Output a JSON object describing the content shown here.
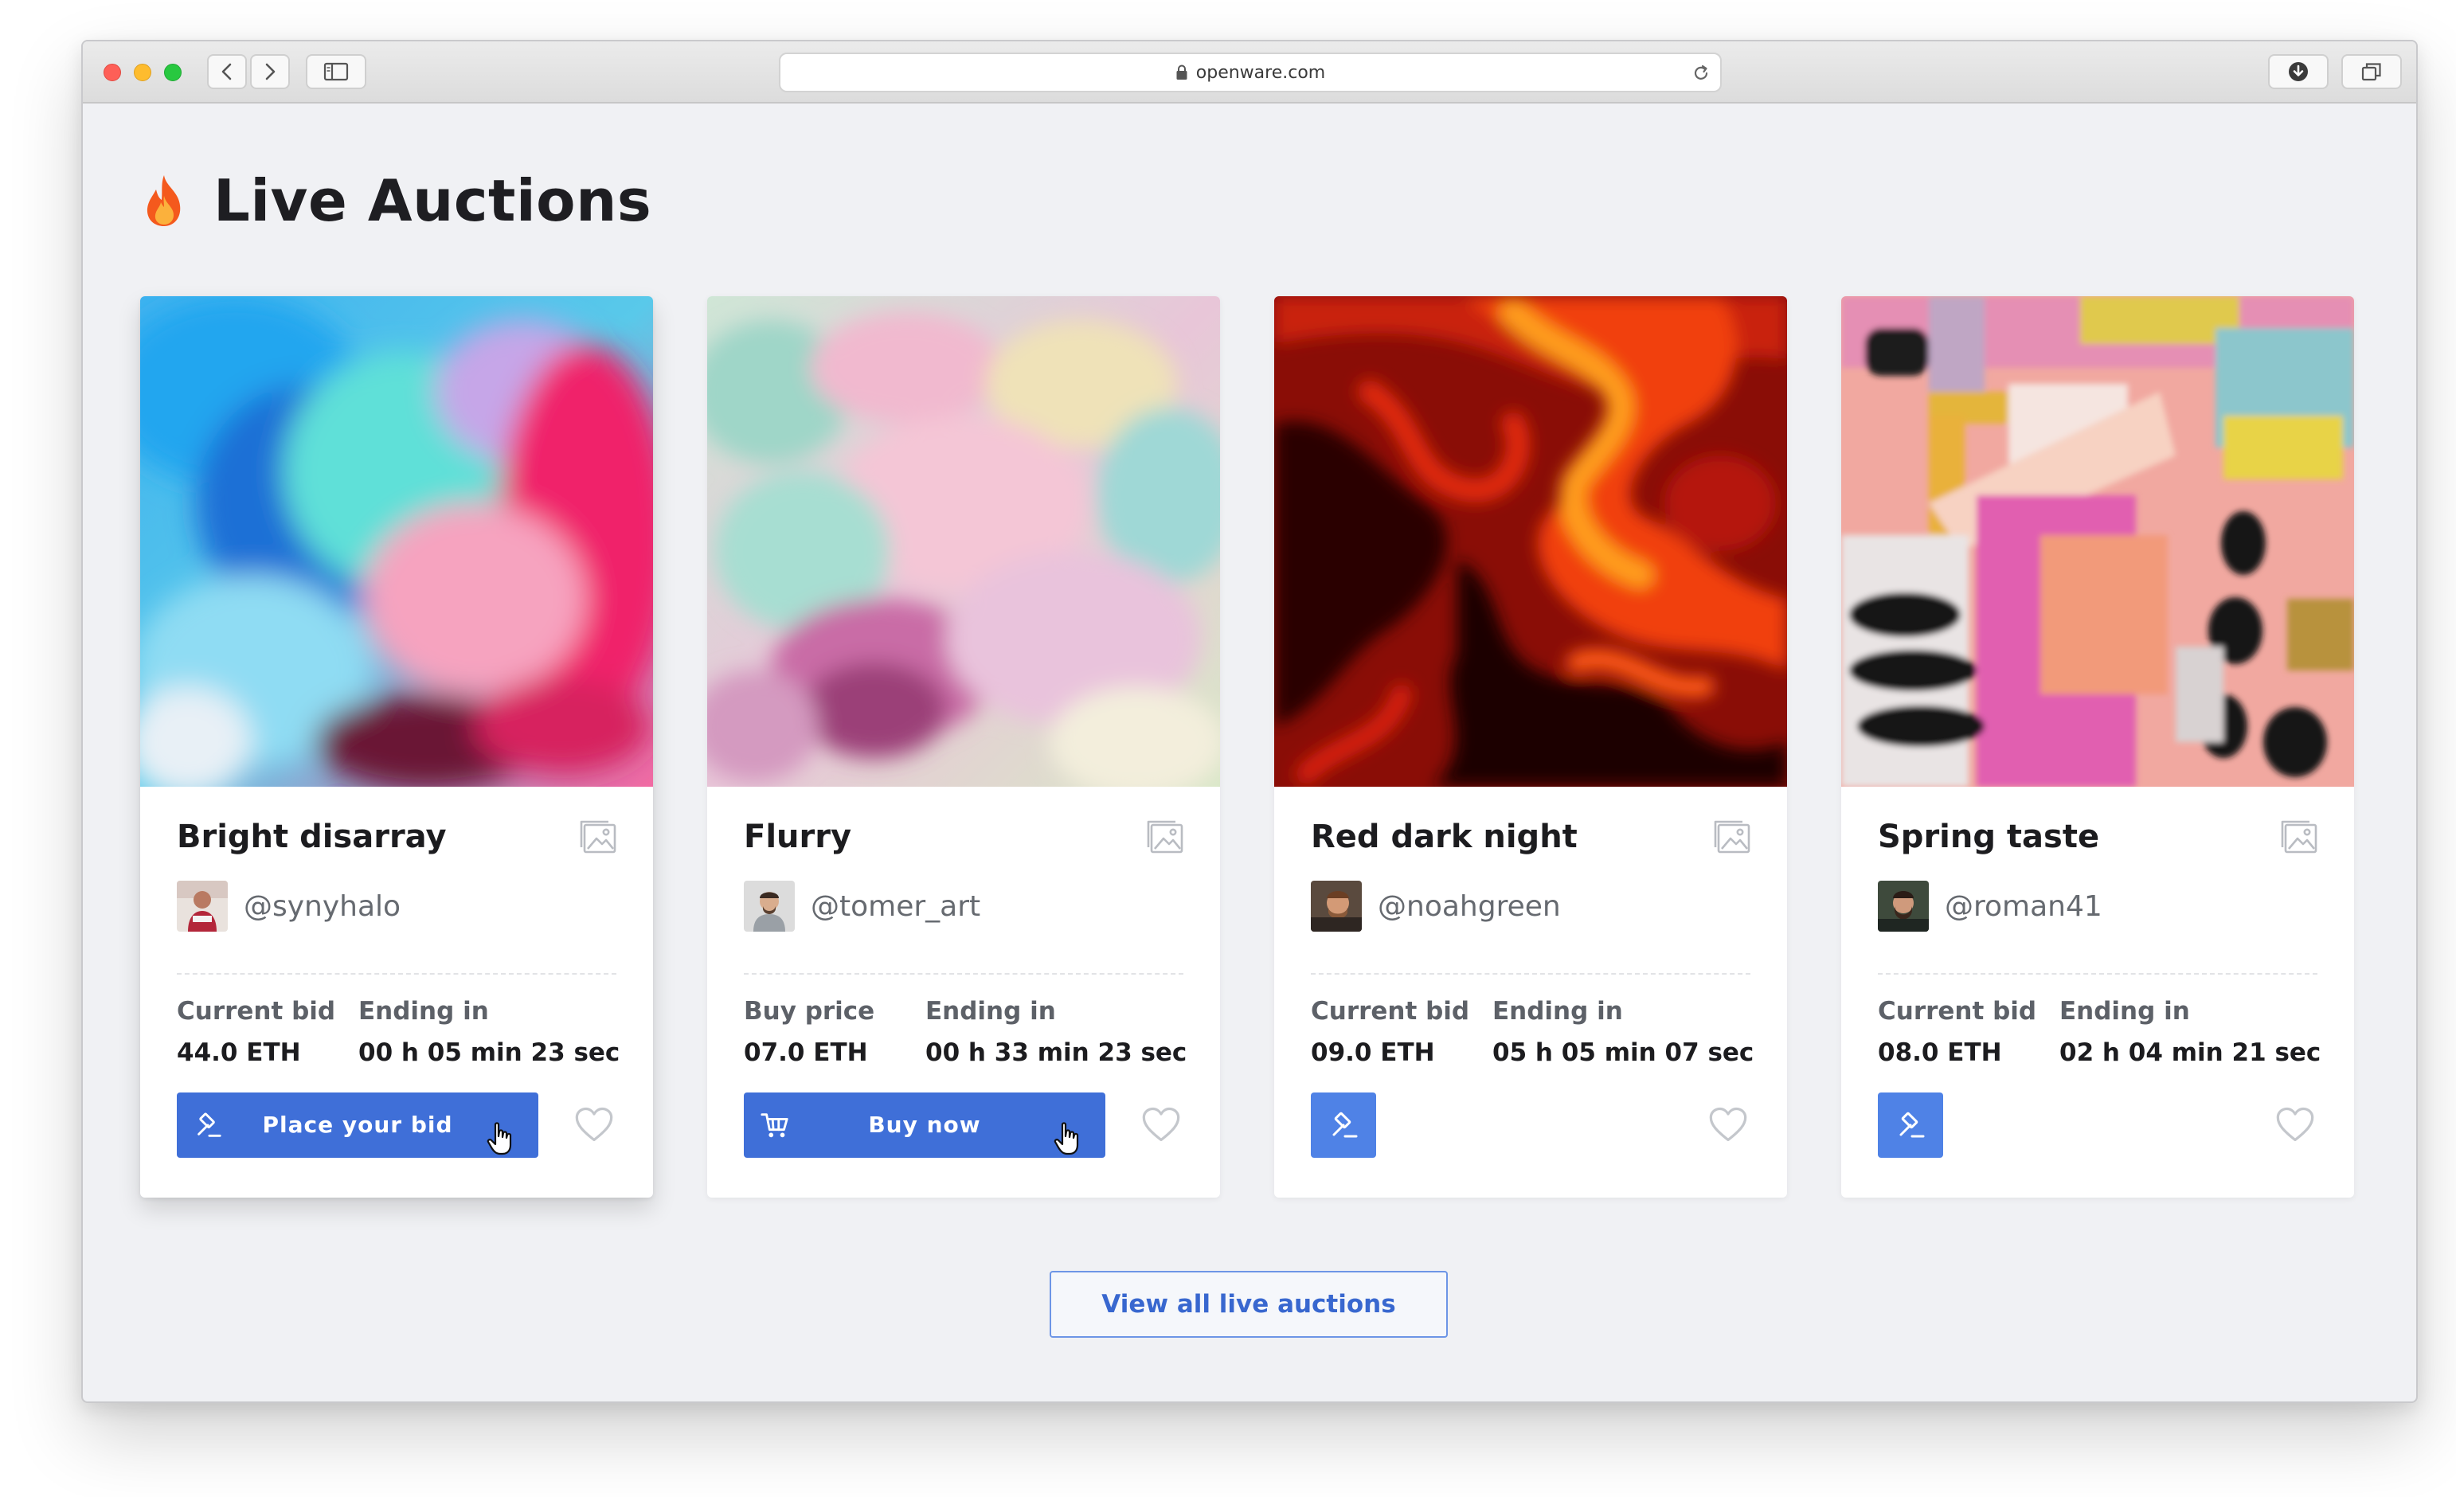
{
  "browser": {
    "url": "openware.com",
    "colors": {
      "close": "#fe5f57",
      "minimize": "#febc2e",
      "maximize": "#28c840"
    },
    "icons": [
      "back-icon",
      "forward-icon",
      "sidebar-icon",
      "lock-icon",
      "reload-icon",
      "download-icon",
      "tabs-icon"
    ]
  },
  "page": {
    "title": "Live Auctions",
    "title_icon": "fire-icon",
    "view_all_label": "View all live auctions",
    "accent_color": "#3f6fd8"
  },
  "cards": [
    {
      "title": "Bright disarray",
      "handle": "@synyhalo",
      "stat1_label": "Current bid",
      "stat1_value": "44.0 ETH",
      "stat2_label": "Ending in",
      "stat2_value": "00 h 05 min 23 sec",
      "button_label": "Place your bid",
      "button_icon": "gavel-icon"
    },
    {
      "title": "Flurry",
      "handle": "@tomer_art",
      "stat1_label": "Buy price",
      "stat1_value": "07.0 ETH",
      "stat2_label": "Ending in",
      "stat2_value": "00 h 33 min 23 sec",
      "button_label": "Buy now",
      "button_icon": "cart-icon"
    },
    {
      "title": "Red dark night",
      "handle": "@noahgreen",
      "stat1_label": "Current bid",
      "stat1_value": "09.0 ETH",
      "stat2_label": "Ending in",
      "stat2_value": "05 h 05 min 07 sec",
      "button_icon": "gavel-icon"
    },
    {
      "title": "Spring taste",
      "handle": "@roman41",
      "stat1_label": "Current bid",
      "stat1_value": "08.0 ETH",
      "stat2_label": "Ending in",
      "stat2_value": "02 h 04 min 21 sec",
      "button_icon": "gavel-icon"
    }
  ]
}
